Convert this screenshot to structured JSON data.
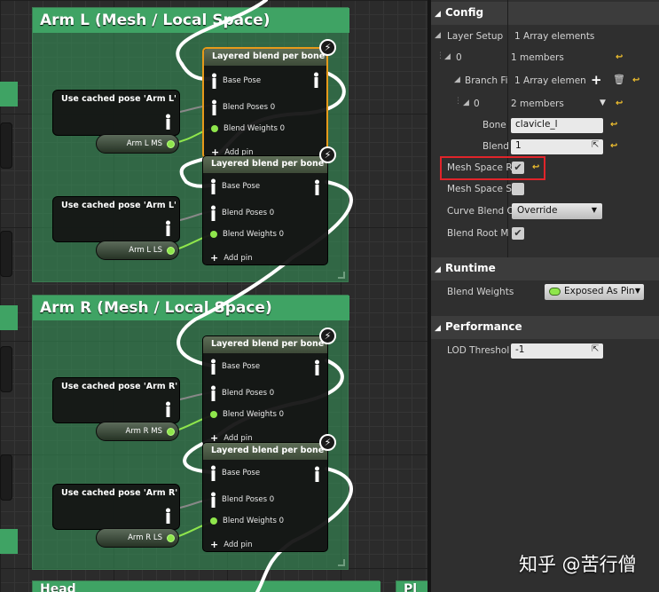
{
  "graph": {
    "comments": [
      {
        "title": "Arm L (Mesh / Local Space)"
      },
      {
        "title": "Arm R (Mesh / Local Space)"
      },
      {
        "title": "Head"
      },
      {
        "title": "Pl"
      }
    ],
    "cached_pose_nodes": [
      {
        "title": "Use cached pose 'Arm L'"
      },
      {
        "title": "Use cached pose 'Arm L'"
      },
      {
        "title": "Use cached pose 'Arm R'"
      },
      {
        "title": "Use cached pose 'Arm R'"
      }
    ],
    "variables": [
      {
        "label": "Arm L MS"
      },
      {
        "label": "Arm L LS"
      },
      {
        "label": "Arm R MS"
      },
      {
        "label": "Arm R LS"
      }
    ],
    "blend_node": {
      "title": "Layered blend per bone",
      "base_pose": "Base Pose",
      "blend_poses": "Blend Poses 0",
      "blend_weights": "Blend Weights 0",
      "add_pin": "Add pin"
    }
  },
  "panel": {
    "config": {
      "title": "Config",
      "layer_setup_label": "Layer Setup",
      "layer_setup_value": "1 Array elements",
      "item0_label": "0",
      "item0_value": "1 members",
      "branch_filters_label": "Branch Fi",
      "branch_filters_value": "1 Array elemen",
      "sub0_label": "0",
      "sub0_value": "2 members",
      "bone_label": "Bone",
      "bone_value": "clavicle_l",
      "blend_label": "Blend",
      "blend_value": "1",
      "mesh_space_rotation_label": "Mesh Space R",
      "mesh_space_rotation_checked": true,
      "mesh_space_scale_label": "Mesh Space S",
      "mesh_space_scale_checked": false,
      "curve_blend_label": "Curve Blend O",
      "curve_blend_value": "Override",
      "blend_root_motion_label": "Blend Root M",
      "blend_root_motion_checked": true
    },
    "runtime": {
      "title": "Runtime",
      "blend_weights_label": "Blend Weights",
      "blend_weights_value": "Exposed As Pin"
    },
    "performance": {
      "title": "Performance",
      "lod_threshold_label": "LOD Threshol",
      "lod_threshold_value": "-1"
    }
  },
  "watermark": "知乎 @苦行僧",
  "colors": {
    "accent_highlight": "#e0242a",
    "comment": "#3fa364",
    "reset_arrow": "#f2c12e",
    "selected_node": "#e69a1a"
  }
}
